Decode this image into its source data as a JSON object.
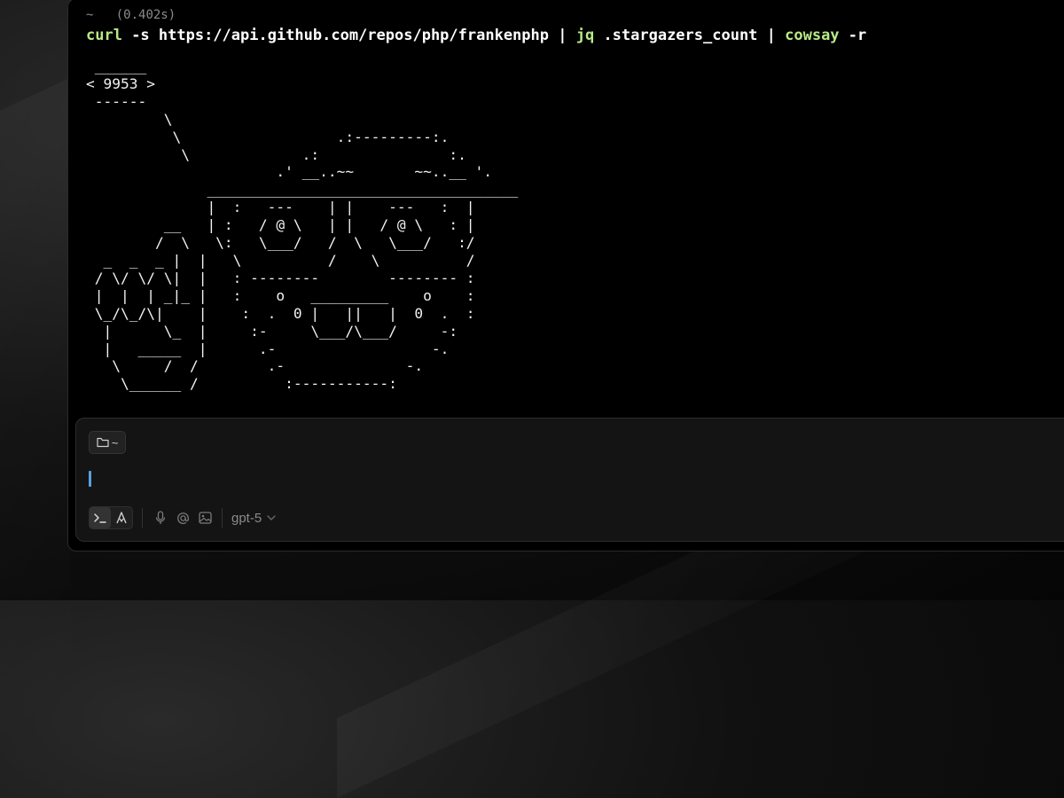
{
  "terminal": {
    "cwd": "~",
    "duration": "(0.402s)",
    "command": {
      "t1": "curl",
      "t2": " -s https://api.github.com/repos/php/frankenphp | ",
      "t3": "jq",
      "t4": " .stargazers_count | ",
      "t5": "cowsay",
      "t6": " -r"
    },
    "output": " ______\n< 9953 >\n ------\n         \\\n          \\                  .:---------:.\n           \\             .:               :.\n                      .' __..~~       ~~..__ '.\n              ____________________________________\n              |  :   ---    | |    ---   :  |\n         __   | :   / @ \\   | |   / @ \\   : |\n        /  \\   \\:   \\___/   /  \\   \\___/   :/\n  _  _  _ |  |   \\          /    \\          /\n / \\/ \\/ \\|  |   : --------        -------- :\n |  |  | _|_ |   :    o   _________    o    :\n \\_/\\_/\\|    |    :  .  0 |   ||   |  0  .  :\n  |      \\_  |     :-     \\___/\\___/     -:\n  |   _____  |      .-                  -.\n   \\     /  /        .-              -.\n    \\______ /          :-----------:"
  },
  "input": {
    "dir_label": "~",
    "model": "gpt-5"
  },
  "icons": {
    "dir": "folder-icon",
    "terminal_mode": "terminal-prompt-icon",
    "agent_mode": "agent-icon",
    "mic": "microphone-icon",
    "mention": "at-mention-icon",
    "image": "image-attach-icon",
    "model_chevron": "chevron-down-icon"
  },
  "colors": {
    "command_highlight": "#b8e986",
    "cursor": "#5aa0e0"
  }
}
